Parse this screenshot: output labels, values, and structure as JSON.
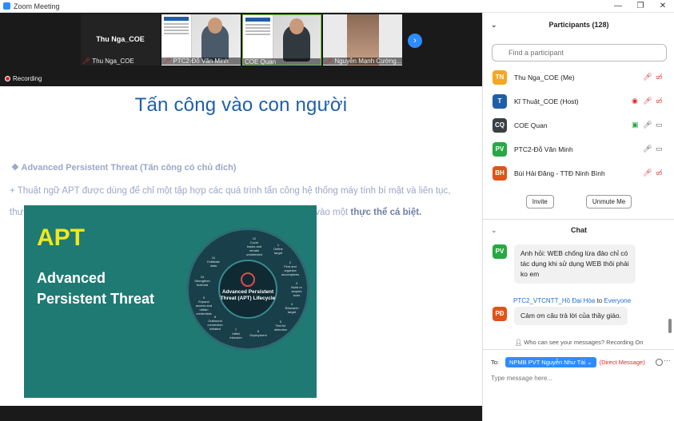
{
  "window": {
    "title": "Zoom Meeting",
    "min": "—",
    "max": "❐",
    "close": "✕"
  },
  "strip": {
    "tiles": [
      {
        "name": "Thu Nga_COE",
        "label": "Thu Nga_COE"
      },
      {
        "name": "PTC2-Đỗ Văn Minh"
      },
      {
        "name": "COE Quan"
      },
      {
        "name": "Nguyễn Mạnh Cường..."
      }
    ],
    "recording": "Recording"
  },
  "slide": {
    "title": "Tấn công vào con người",
    "subtitle": "❖  Advanced Persistent Threat  (Tấn công có chủ đích)",
    "para1": "+ Thuật ngữ APT được dùng để chỉ một tập hợp các quá trình tấn công hệ thống máy tính bí mật và liên tục,",
    "para2_start": "thư",
    "para2_mid": "vào một ",
    "para2_bold": "thực thể cá biệt."
  },
  "overlay": {
    "apt": "APT",
    "line1": "Advanced",
    "line2": "Persistent Threat",
    "wheel_center": "Advanced Persistent Threat (APT) Lifecycle",
    "labels": [
      "Define target",
      "Find and organize accomplices",
      "Build or acquire tools",
      "Research target",
      "Test for detection",
      "Deployment",
      "Initial intrusion",
      "Outbound connection initiated",
      "Expand access and obtain credentials",
      "Strengthen foothold",
      "Exfiltrate data",
      "Cover tracks and remain undetected"
    ],
    "label_numbers": [
      "1",
      "2",
      "3",
      "4",
      "5",
      "6",
      "7",
      "8",
      "9",
      "10",
      "11",
      "12"
    ]
  },
  "participants": {
    "header": "Participants (128)",
    "search_placeholder": "Find a participant",
    "list": [
      {
        "initials": "TN",
        "name": "Thu Nga_COE (Me)",
        "color": "#f5a623"
      },
      {
        "initials": "T",
        "name": "Kĩ Thuật_COE (Host)",
        "color": "#1f5fa8"
      },
      {
        "initials": "CQ",
        "name": "COE Quan",
        "color": "#3a3f44"
      },
      {
        "initials": "PV",
        "name": "PTC2-Đỗ Văn Minh",
        "color": "#27a844"
      },
      {
        "initials": "BH",
        "name": "Bùi Hải Đăng - TTĐ Ninh Bình",
        "color": "#e0531a"
      }
    ],
    "invite": "Invite",
    "unmute": "Unmute Me"
  },
  "chat": {
    "header": "Chat",
    "messages": [
      {
        "initials": "PV",
        "color": "#27a844",
        "lines": [
          "Anh hỏi: WEB chống lừa đảo chỉ có",
          "tác dụng khi sử dụng WEB thôi phải",
          "ko em"
        ]
      },
      {
        "initials": "PĐ",
        "color": "#e0531a",
        "lines": [
          "Cảm ơn câu trả lời của thầy giáo."
        ]
      }
    ],
    "sender": "PTC2_VTCNTT_Hồ Đại Hòa",
    "to_word": " to ",
    "to_target": "Everyone",
    "who_can_see": "Who can see your messages? Recording On",
    "to_label": "To:",
    "recipient": "NPMB PVT Nguyễn Như Tài ⌄",
    "direct": "(Direct Message)",
    "placeholder": "Type message here..."
  }
}
